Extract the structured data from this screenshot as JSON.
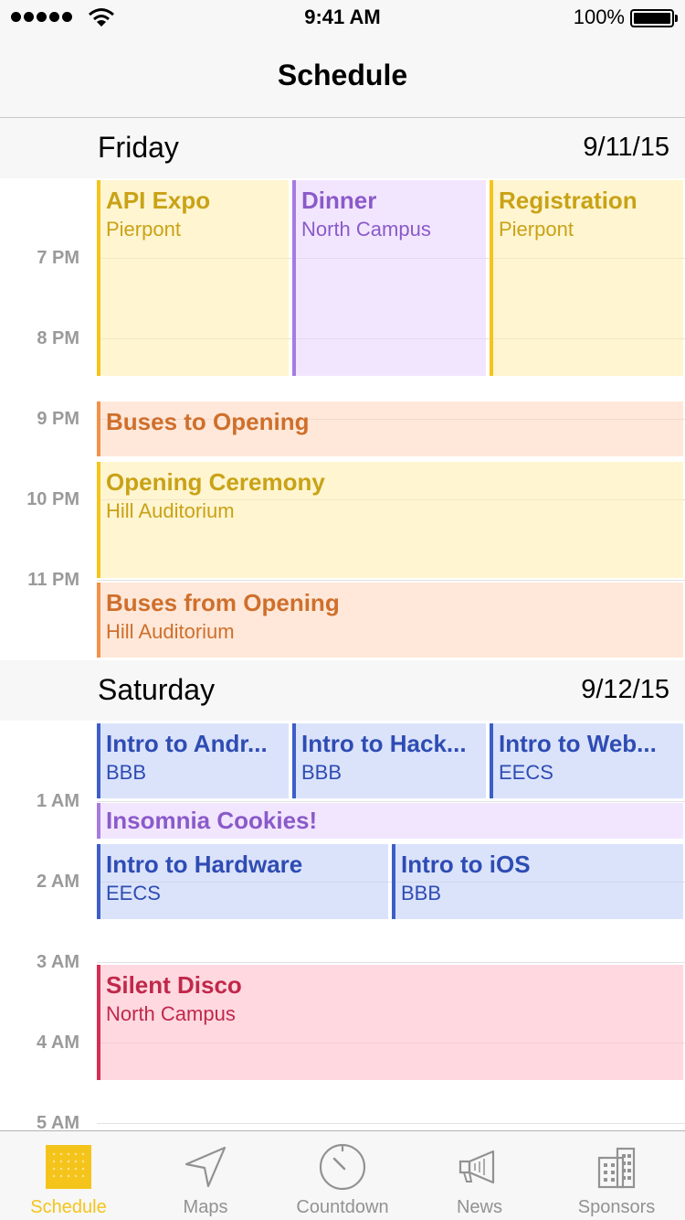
{
  "status_bar": {
    "time": "9:41 AM",
    "battery": "100%"
  },
  "nav": {
    "title": "Schedule"
  },
  "days": [
    {
      "name": "Friday",
      "date": "9/11/15"
    },
    {
      "name": "Saturday",
      "date": "9/12/15"
    }
  ],
  "friday_times": [
    "7 PM",
    "8 PM",
    "9 PM",
    "10 PM",
    "11 PM"
  ],
  "saturday_times": [
    "1 AM",
    "2 AM",
    "3 AM",
    "4 AM",
    "5 AM"
  ],
  "events": {
    "api_expo": {
      "title": "API Expo",
      "location": "Pierpont"
    },
    "dinner": {
      "title": "Dinner",
      "location": "North Campus"
    },
    "registration": {
      "title": "Registration",
      "location": "Pierpont"
    },
    "buses_to_opening": {
      "title": "Buses to Opening"
    },
    "opening_ceremony": {
      "title": "Opening Ceremony",
      "location": "Hill Auditorium"
    },
    "buses_from_opening": {
      "title": "Buses from Opening",
      "location": "Hill Auditorium"
    },
    "intro_android": {
      "title": "Intro to Andr...",
      "location": "BBB"
    },
    "intro_hack": {
      "title": "Intro to Hack...",
      "location": "BBB"
    },
    "intro_web": {
      "title": "Intro to Web...",
      "location": "EECS"
    },
    "insomnia_cookies": {
      "title": "Insomnia Cookies!"
    },
    "intro_hardware": {
      "title": "Intro to Hardware",
      "location": "EECS"
    },
    "intro_ios": {
      "title": "Intro to iOS",
      "location": "BBB"
    },
    "silent_disco": {
      "title": "Silent Disco",
      "location": "North Campus"
    }
  },
  "tabs": [
    {
      "label": "Schedule",
      "icon": "calendar-grid-icon",
      "active": true
    },
    {
      "label": "Maps",
      "icon": "location-arrow-icon",
      "active": false
    },
    {
      "label": "Countdown",
      "icon": "timer-icon",
      "active": false
    },
    {
      "label": "News",
      "icon": "megaphone-icon",
      "active": false
    },
    {
      "label": "Sponsors",
      "icon": "building-icon",
      "active": false
    }
  ],
  "colors": {
    "accent": "#f5c41b",
    "yellow_event": "#f5c41b",
    "purple_event": "#a67be0",
    "orange_event": "#f29248",
    "blue_event": "#3d5ec9",
    "pink_event": "#d42e55"
  }
}
